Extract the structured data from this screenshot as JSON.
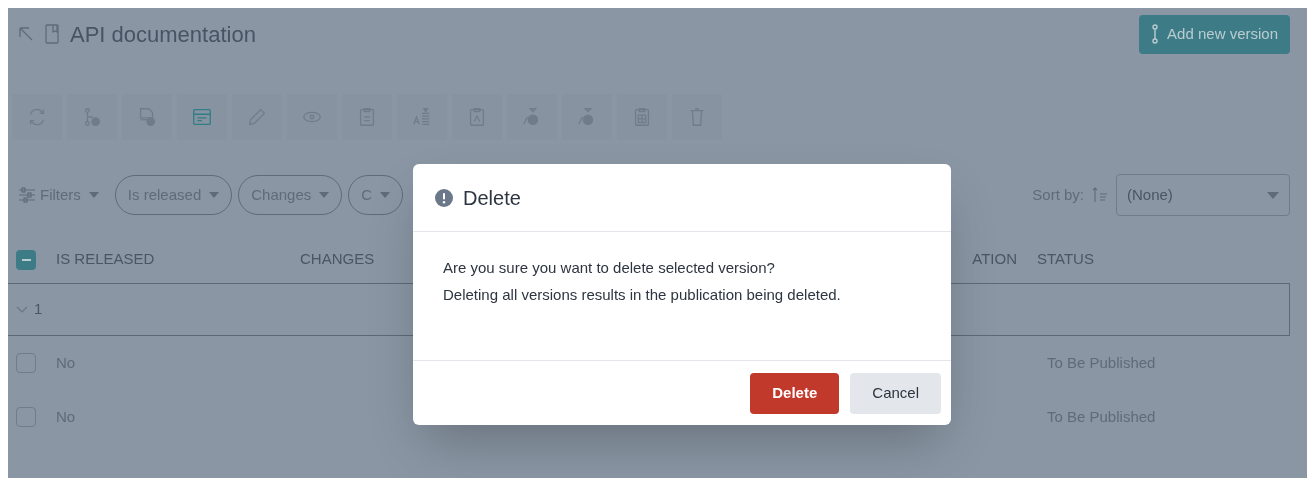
{
  "header": {
    "title": "API documentation",
    "add_button": "Add new version"
  },
  "toolbar": [
    {
      "disabled": true
    },
    {
      "disabled": true
    },
    {
      "disabled": true
    },
    {
      "disabled": false
    },
    {
      "disabled": true
    },
    {
      "disabled": true
    },
    {
      "disabled": true
    },
    {
      "disabled": true
    },
    {
      "disabled": true
    },
    {
      "disabled": true
    },
    {
      "disabled": true
    },
    {
      "disabled": true
    },
    {
      "disabled": true
    }
  ],
  "filters": {
    "label": "Filters",
    "chips": [
      "Is released",
      "Changes",
      "C"
    ],
    "sort_label": "Sort by:",
    "sort_value": "(None)"
  },
  "table": {
    "select_all_checked": true,
    "columns": [
      "IS RELEASED",
      "CHANGES",
      "ATION",
      "STATUS"
    ],
    "group": {
      "label": "1",
      "expanded": true
    },
    "rows": [
      {
        "checked": false,
        "is_released": "No",
        "status": "To Be Published"
      },
      {
        "checked": false,
        "is_released": "No",
        "status": "To Be Published"
      }
    ]
  },
  "dialog": {
    "title": "Delete",
    "lines": [
      "Are you sure you want to delete selected version?",
      "Deleting all versions results in the publication being deleted."
    ],
    "buttons": [
      {
        "label": "Delete",
        "kind": "primary"
      },
      {
        "label": "Cancel",
        "kind": "secondary"
      }
    ]
  }
}
